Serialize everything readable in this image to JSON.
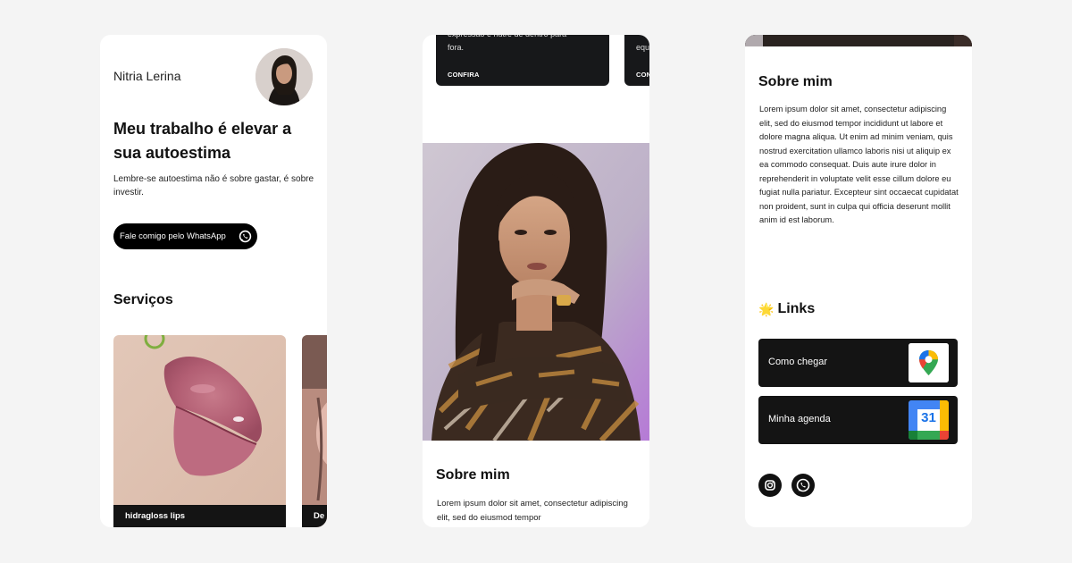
{
  "card1": {
    "name": "Nitria Lerina",
    "headline": "Meu trabalho é elevar a sua autoestima",
    "subtitle": "Lembre-se autoestima não é sobre gastar, é sobre investir.",
    "whatsapp_button": "Fale comigo pelo WhatsApp",
    "services_title": "Serviços",
    "services": [
      {
        "label": "hidragloss lips"
      },
      {
        "label": "De"
      }
    ]
  },
  "card2": {
    "service_cards": [
      {
        "text": "expressão e nutre de dentro para\nfora.",
        "link": "CONFIRA"
      },
      {
        "text": "equ",
        "link": "CON"
      }
    ],
    "about_title": "Sobre mim",
    "about_text": "Lorem ipsum dolor sit amet, consectetur adipiscing elit, sed do eiusmod tempor"
  },
  "card3": {
    "about_title": "Sobre mim",
    "about_text": "Lorem ipsum dolor sit amet, consectetur adipiscing elit, sed do eiusmod tempor incididunt ut labore et dolore magna aliqua. Ut enim ad minim veniam, quis nostrud exercitation ullamco laboris nisi ut aliquip ex ea commodo consequat. Duis aute irure dolor in reprehenderit in voluptate velit esse cillum dolore eu fugiat nulla pariatur. Excepteur sint occaecat cupidatat non proident, sunt in culpa qui officia deserunt mollit anim id est laborum.",
    "links_emoji": "🌟",
    "links_title": "Links",
    "links": [
      {
        "label": "Como chegar",
        "icon": "google-maps-icon"
      },
      {
        "label": "Minha agenda",
        "icon": "google-calendar-icon",
        "icon_text": "31"
      }
    ],
    "social": [
      "instagram-icon",
      "whatsapp-icon"
    ]
  },
  "colors": {
    "background": "#f4f4f4",
    "card": "#ffffff",
    "dark": "#141414",
    "accent_purple": "#b57ad6"
  }
}
